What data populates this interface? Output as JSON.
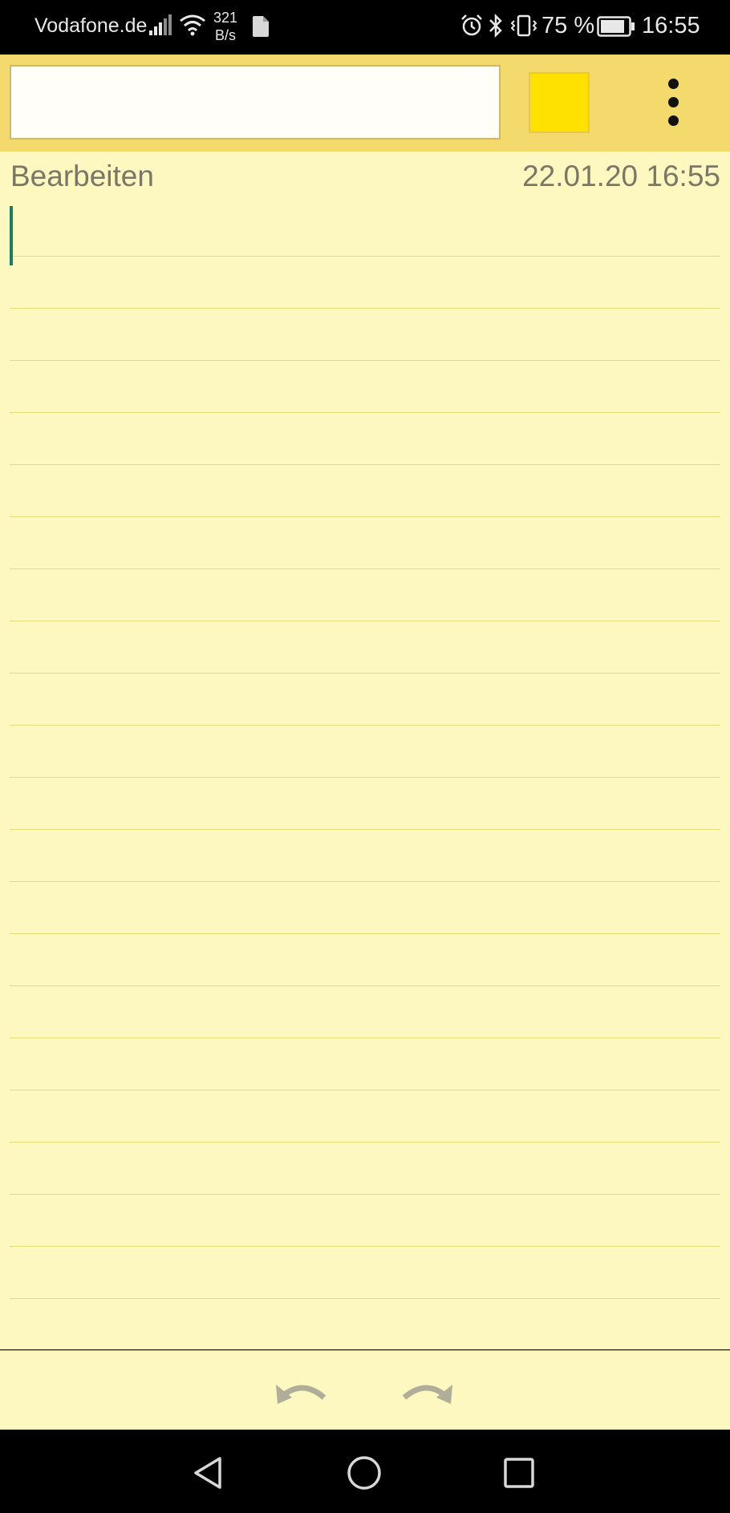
{
  "status_bar": {
    "carrier": "Vodafone.de",
    "net_speed_value": "321",
    "net_speed_unit": "B/s",
    "battery_percent": "75 %",
    "time": "16:55",
    "icons": [
      "signal-icon",
      "wifi-icon",
      "file-icon",
      "alarm-icon",
      "bluetooth-icon",
      "vibrate-icon",
      "battery-icon"
    ]
  },
  "toolbar": {
    "title_value": "",
    "color_swatch": "#ffe100",
    "menu_icon": "more-vert-icon"
  },
  "note": {
    "mode_label": "Bearbeiten",
    "timestamp": "22.01.20 16:55",
    "content": ""
  },
  "actions": {
    "undo_icon": "undo-icon",
    "redo_icon": "redo-icon"
  },
  "nav_bar": {
    "icons": [
      "back-icon",
      "home-icon",
      "recent-apps-icon"
    ]
  },
  "colors": {
    "toolbar_bg": "#f4da6c",
    "note_bg": "#fdf7c0",
    "ruled_line": "#e4db7a",
    "cursor": "#1a7d6a"
  }
}
